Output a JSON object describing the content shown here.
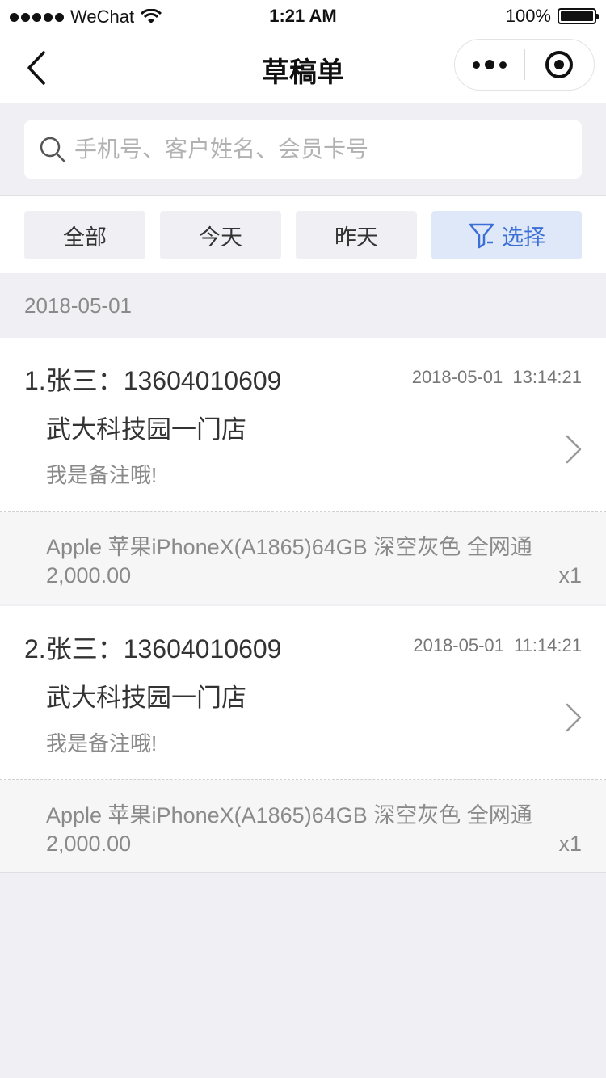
{
  "status_bar": {
    "carrier": "WeChat",
    "time": "1:21 AM",
    "battery": "100%"
  },
  "nav": {
    "title": "草稿单"
  },
  "search": {
    "placeholder": "手机号、客户姓名、会员卡号"
  },
  "filters": {
    "all": "全部",
    "today": "今天",
    "yesterday": "昨天",
    "select": "选择"
  },
  "date_group": "2018-05-01",
  "orders": [
    {
      "title": "1.张三：13604010609",
      "datetime": "2018-05-01 13:14:21",
      "store": "武大科技园一门店",
      "note": "我是备注哦!",
      "product": "Apple 苹果iPhoneX(A1865)64GB 深空灰色 全网通",
      "price": "2,000.00",
      "qty": "x1"
    },
    {
      "title": "2.张三：13604010609",
      "datetime": "2018-05-01 11:14:21",
      "store": "武大科技园一门店",
      "note": "我是备注哦!",
      "product": "Apple 苹果iPhoneX(A1865)64GB 深空灰色 全网通",
      "price": "2,000.00",
      "qty": "x1"
    }
  ],
  "colors": {
    "accent": "#3b6fd6",
    "accent_bg": "#dfe8f8",
    "page_bg": "#efeff4"
  },
  "icons": {
    "back": "chevron-left-icon",
    "more": "more-dots-icon",
    "close": "target-circle-icon",
    "search": "search-icon",
    "filter": "funnel-icon",
    "row_arrow": "chevron-right-icon"
  }
}
